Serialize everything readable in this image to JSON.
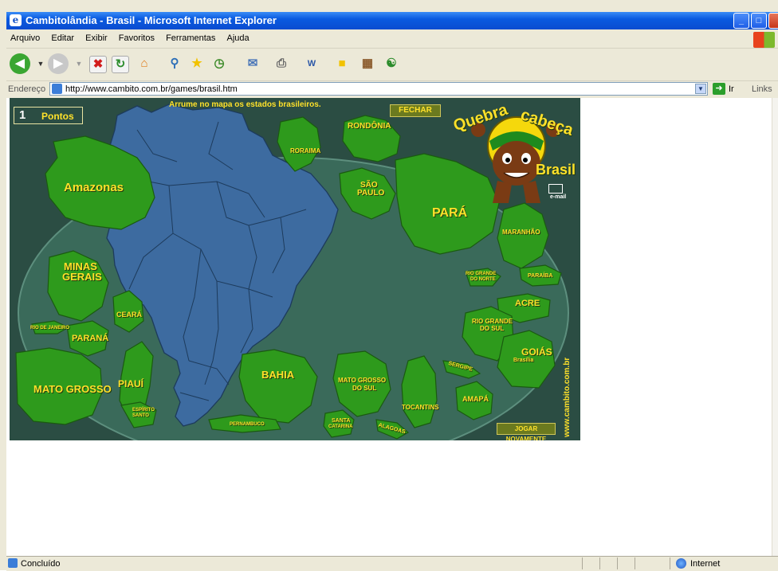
{
  "window": {
    "title": "Cambitolândia - Brasil - Microsoft Internet Explorer",
    "controls": {
      "minimize": "_",
      "maximize": "□",
      "close": "X"
    }
  },
  "menu": [
    "Arquivo",
    "Editar",
    "Exibir",
    "Favoritos",
    "Ferramentas",
    "Ajuda"
  ],
  "address": {
    "label": "Endereço",
    "url": "http://www.cambito.com.br/games/brasil.htm",
    "go_label": "Ir",
    "links_label": "Links"
  },
  "status": {
    "text": "Concluído",
    "zone": "Internet"
  },
  "game": {
    "instruction": "Arrume no mapa  os estados brasileiros.",
    "score_value": "1",
    "score_label": "Pontos",
    "close_label": "FECHAR",
    "play_again_label": "JOGAR NOVAMENTE",
    "site": "www.cambito.com.br",
    "email_label": "e-mail",
    "logo_text": "Quebra cabeça Brasil",
    "states": {
      "amazonas": "Amazonas",
      "roraima": "RORAIMA",
      "rondonia": "RONDÔNIA",
      "sao_paulo_1": "SÃO",
      "sao_paulo_2": "PAULO",
      "para": "PARÁ",
      "maranhao": "MARANHÃO",
      "minas_1": "MINAS",
      "minas_2": "GERAIS",
      "rn_1": "RIO GRANDE",
      "rn_2": "DO NORTE",
      "paraiba": "PARAÍBA",
      "ceara": "CEARÁ",
      "acre": "ACRE",
      "rj": "RIO DE JANEIRO",
      "parana": "PARANÁ",
      "rs_1": "RIO GRANDE",
      "rs_2": "DO SUL",
      "goias": "GOIÁS",
      "brasilia": "Brasília",
      "mato_grosso": "MATO GROSSO",
      "piaui": "PIAUÍ",
      "bahia": "BAHIA",
      "ms_1": "MATO GROSSO",
      "ms_2": "DO SUL",
      "sergipe": "SERGIPE",
      "tocantins": "TOCANTINS",
      "amapa": "AMAPÁ",
      "es_1": "ESPÍRITO",
      "es_2": "SANTO",
      "pernambuco": "PERNAMBUCO",
      "sc_1": "SANTA",
      "sc_2": "CATARINA",
      "alagoas": "ALAGOAS"
    }
  }
}
